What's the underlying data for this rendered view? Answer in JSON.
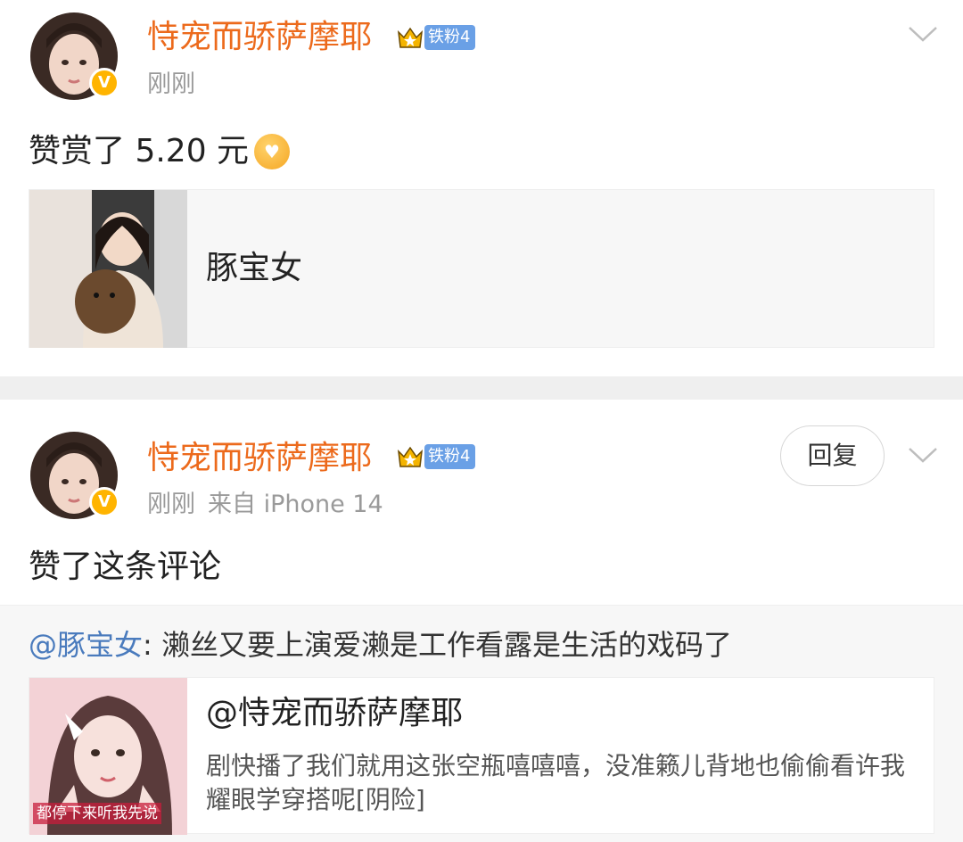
{
  "post1": {
    "username": "恃宠而骄萨摩耶",
    "fan_badge": "铁粉4",
    "time": "刚刚",
    "reward_text": "赞赏了 5.20 元",
    "link_title": "豚宝女"
  },
  "post2": {
    "username": "恃宠而骄萨摩耶",
    "fan_badge": "铁粉4",
    "time": "刚刚",
    "source": "来自 iPhone 14",
    "reply_label": "回复",
    "action_text": "赞了这条评论",
    "quote": {
      "mention": "@豚宝女",
      "text": ": 濑丝又要上演爱濑是工作看露是生活的戏码了"
    },
    "card": {
      "title": "@恃宠而骄萨摩耶",
      "text": "剧快播了我们就用这张空瓶嘻嘻嘻，没准籁儿背地也偷偷看许我耀眼学穿搭呢[阴险]",
      "thumb_caption": "都停下来听我先说"
    }
  },
  "icons": [
    "verified-v-icon",
    "crown-icon",
    "chevron-down-icon",
    "reward-coin-icon"
  ],
  "colors": {
    "username": "#ec6a1c",
    "mention": "#4a7bbd",
    "fan_badge": "#6aa0e6",
    "verified": "#ffb400",
    "separator": "#efefef"
  }
}
